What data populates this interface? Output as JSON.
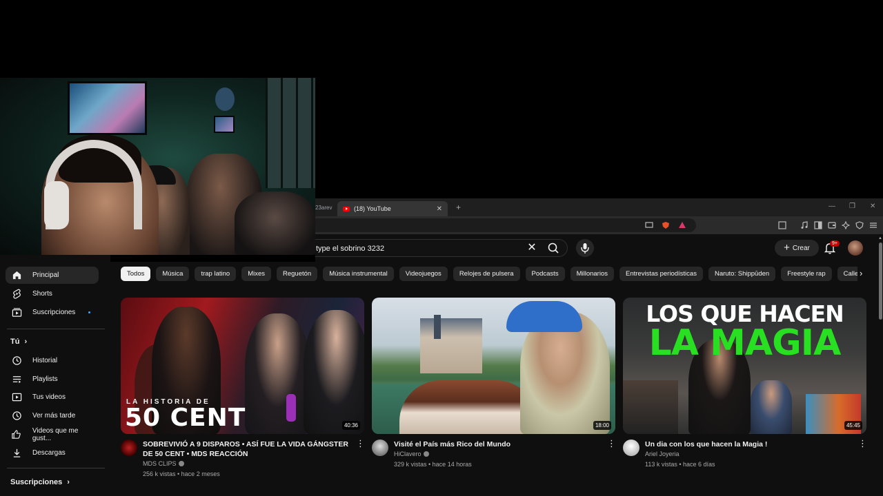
{
  "browser": {
    "prev_tab_fragment": "23arev",
    "active_tab_title": "(18) YouTube",
    "tab_close": "✕",
    "new_tab": "+",
    "window_minimize": "—",
    "window_maximize": "❐",
    "window_close": "✕"
  },
  "masthead": {
    "search_value": "type el sobrino 3232",
    "clear_glyph": "✕",
    "create_label": "Crear",
    "create_glyph": "+",
    "notifications_badge": "9+"
  },
  "sidebar": {
    "items": [
      {
        "label": "Principal",
        "icon": "home-icon"
      },
      {
        "label": "Shorts",
        "icon": "shorts-icon"
      },
      {
        "label": "Suscripciones",
        "icon": "subscriptions-icon"
      }
    ],
    "you_heading": "Tú",
    "you_items": [
      {
        "label": "Historial",
        "icon": "history-icon"
      },
      {
        "label": "Playlists",
        "icon": "playlists-icon"
      },
      {
        "label": "Tus videos",
        "icon": "your-videos-icon"
      },
      {
        "label": "Ver más tarde",
        "icon": "watch-later-icon"
      },
      {
        "label": "Videos que me gust...",
        "icon": "liked-icon"
      },
      {
        "label": "Descargas",
        "icon": "downloads-icon"
      }
    ],
    "subscriptions_heading": "Suscripciones",
    "chevron": "›"
  },
  "chips": [
    "Todos",
    "Música",
    "trap latino",
    "Mixes",
    "Reguetón",
    "Música instrumental",
    "Videojuegos",
    "Relojes de pulsera",
    "Podcasts",
    "Millonarios",
    "Entrevistas periodísticas",
    "Naruto: Shippūden",
    "Freestyle rap",
    "Calles"
  ],
  "chip_next": "›",
  "videos": [
    {
      "title": "SOBREVIVIÓ A 9 DISPAROS • ASÍ FUE LA VIDA GÁNGSTER DE 50 CENT • MDS REACCIÓN",
      "channel": "MDS CLIPS",
      "stats": "256 k vistas • hace 2 meses",
      "duration": "40:36",
      "thumb_small": "LA HISTORIA DE",
      "thumb_big": "50 CENT",
      "more": "⋮"
    },
    {
      "title": "Visité el País más Rico del Mundo",
      "channel": "HiClavero",
      "stats": "329 k vistas • hace 14 horas",
      "duration": "18:00",
      "more": "⋮"
    },
    {
      "title": "Un dia con los que hacen la Magia !",
      "channel": "Ariel Joyeria",
      "stats": "113 k vistas • hace 6 días",
      "duration": "45:45",
      "thumb_line1": "LOS QUE HACEN",
      "thumb_line2": "LA MAGIA",
      "more": "⋮"
    }
  ],
  "colors": {
    "background": "#0f0f0f",
    "chip": "#272727",
    "accent_red": "#ff0000",
    "thumb_green_text": "#28e021"
  }
}
